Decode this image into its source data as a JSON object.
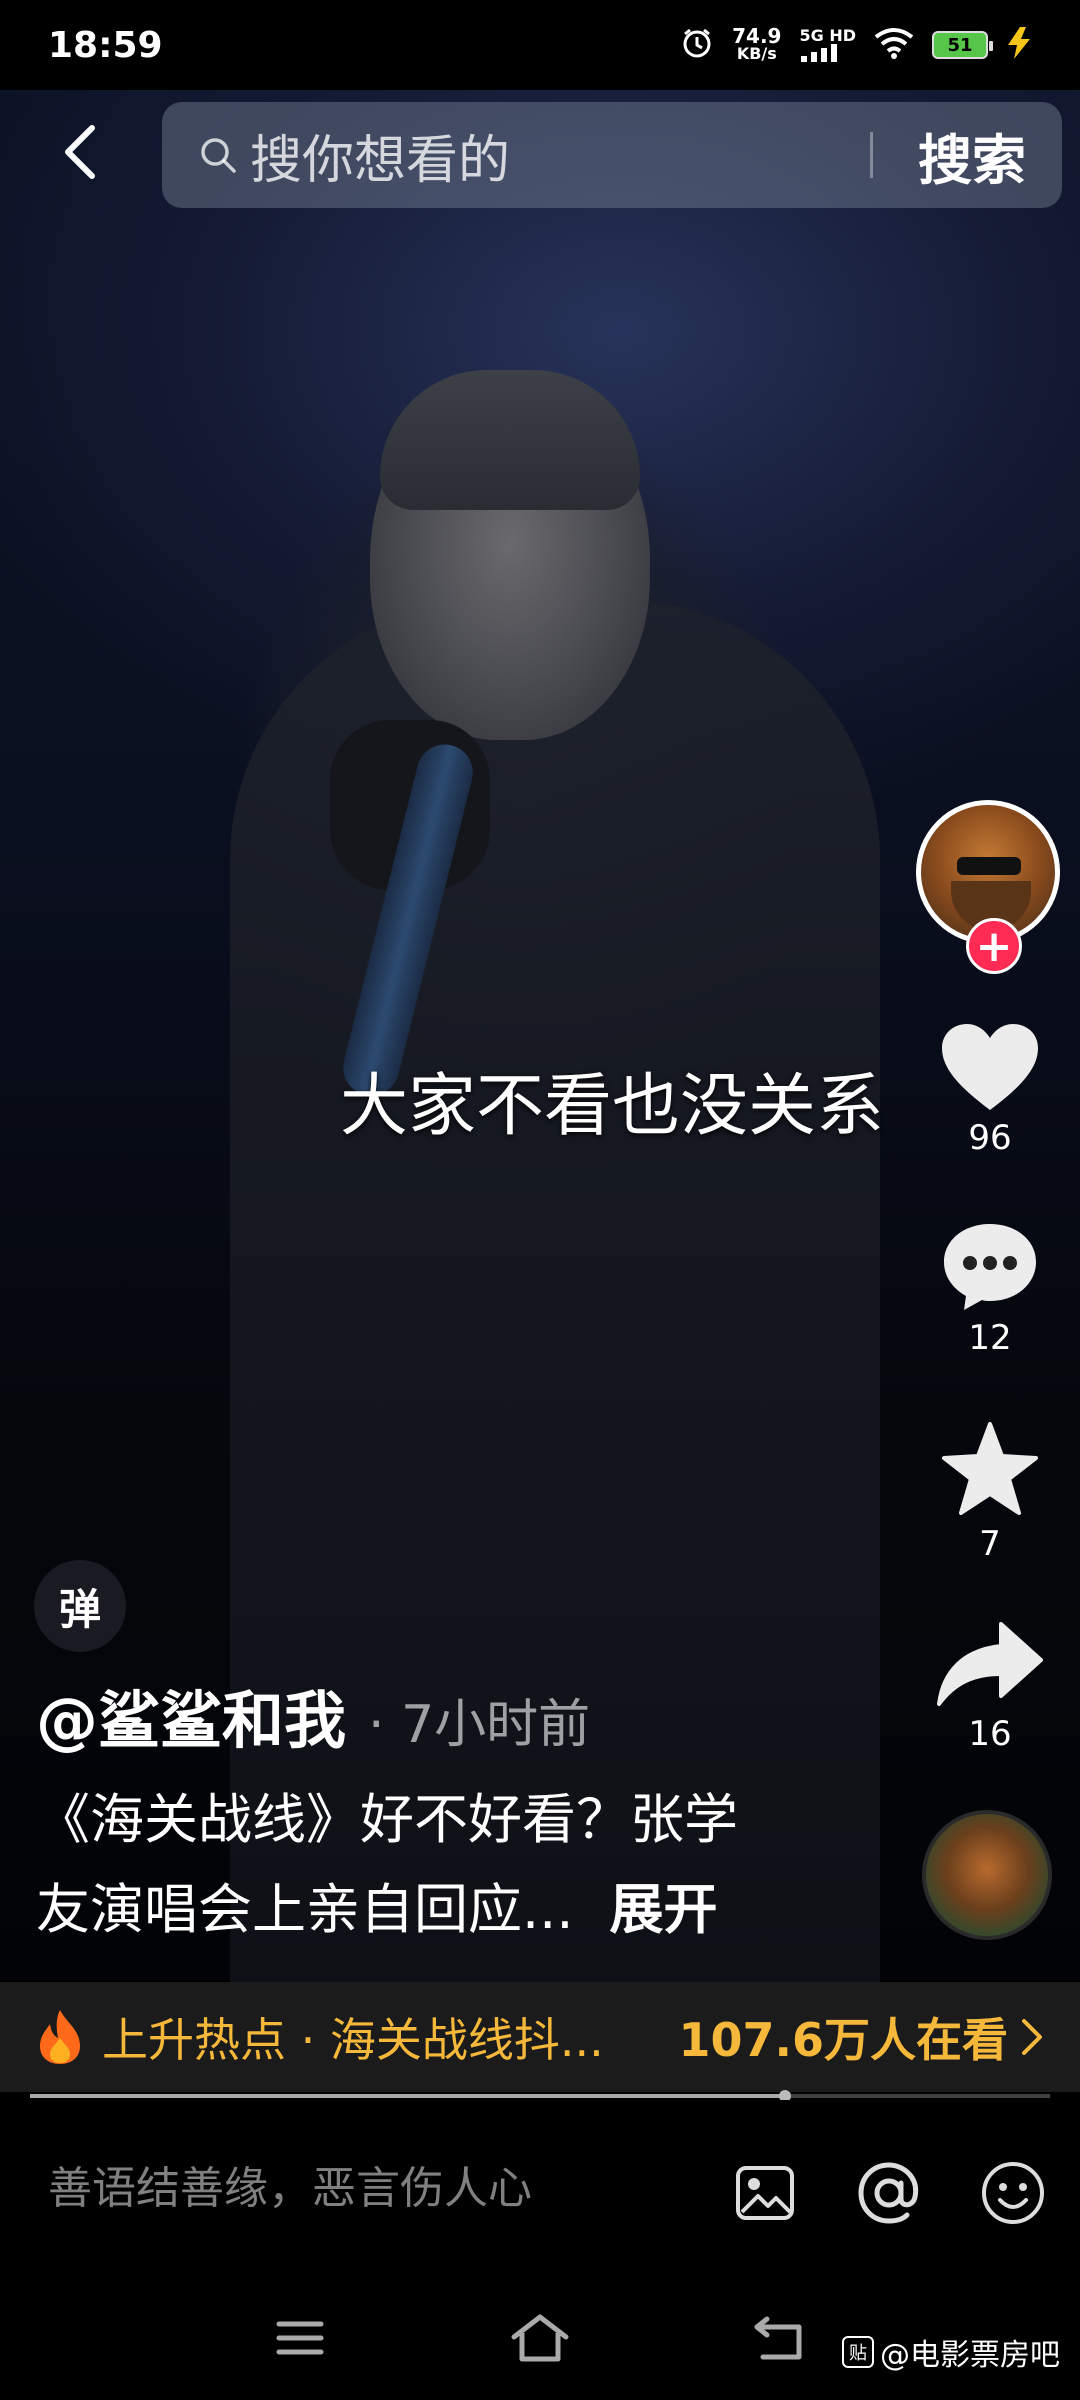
{
  "status_bar": {
    "time": "18:59",
    "net_speed_value": "74.9",
    "net_speed_unit": "KB/s",
    "signal_label": "5G HD",
    "battery": "51"
  },
  "search": {
    "placeholder": "搜你想看的",
    "submit_label": "搜索"
  },
  "video": {
    "subtitle": "大家不看也没关系"
  },
  "actions": {
    "like_count": "96",
    "comment_count": "12",
    "favorite_count": "7",
    "share_count": "16",
    "follow_symbol": "+"
  },
  "danmaku_label": "弹",
  "post": {
    "author": "@鲨鲨和我",
    "time": "· 7小时前",
    "description_line1": "《海关战线》好不好看？张学",
    "description_line2": "友演唱会上亲自回应...",
    "expand_label": "展开"
  },
  "hot_bar": {
    "topic": "上升热点 · 海关战线抖...",
    "viewers": "107.6万人在看"
  },
  "progress": {
    "fraction": 0.74
  },
  "comment_bar": {
    "placeholder": "善语结善缘，恶言伤人心"
  },
  "watermark": {
    "logo": "贴",
    "text": "@电影票房吧"
  },
  "colors": {
    "accent_red": "#fe2c55",
    "hot_orange": "#f5b83a",
    "battery_green": "#57c54a"
  }
}
